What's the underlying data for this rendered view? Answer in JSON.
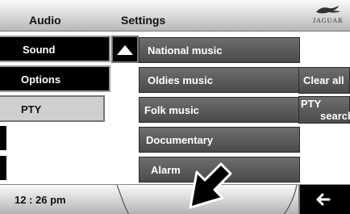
{
  "header": {
    "audio_tab": "Audio",
    "settings_tab": "Settings",
    "brand": "JAGUAR"
  },
  "menu": {
    "sound": "Sound",
    "options": "Options",
    "pty": "PTY"
  },
  "list": {
    "items": [
      "National music",
      "Oldies music",
      "Folk music",
      "Documentary",
      "Alarm"
    ]
  },
  "side_actions": {
    "clear_all": "Clear all",
    "pty_search_line1": "PTY",
    "pty_search_line2": "search"
  },
  "footer": {
    "clock": "12 : 26 pm",
    "back_icon": "left-arrow-icon"
  },
  "icons": {
    "scroll_up": "up-triangle-icon",
    "pointer": "pointer-arrow-icon",
    "logo": "jaguar-leaper-icon"
  }
}
